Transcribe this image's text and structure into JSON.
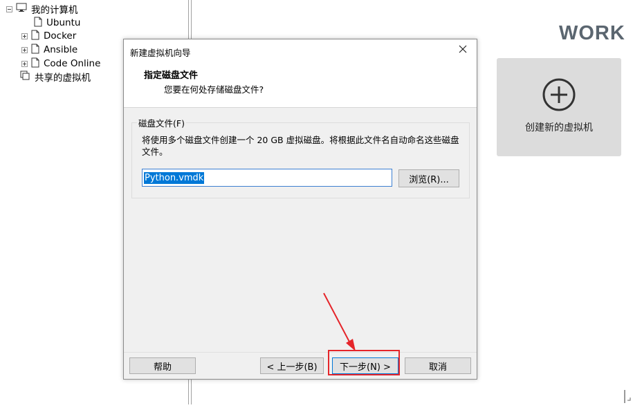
{
  "tree": {
    "items": [
      {
        "label": "我的计算机",
        "icon": "computer-icon",
        "expander": "minus"
      },
      {
        "label": "Ubuntu",
        "icon": "vm-page-icon",
        "expander": ""
      },
      {
        "label": "Docker",
        "icon": "vm-page-icon",
        "expander": "plus"
      },
      {
        "label": "Ansible",
        "icon": "vm-page-icon",
        "expander": "plus"
      },
      {
        "label": "Code Online",
        "icon": "vm-page-icon",
        "expander": "plus"
      },
      {
        "label": "共享的虚拟机",
        "icon": "shared-vms-icon",
        "expander": ""
      }
    ]
  },
  "home": {
    "title": "WORK",
    "create_tile_label": "创建新的虚拟机",
    "create_tile_icon": "plus-circle-icon"
  },
  "dialog": {
    "title": "新建虚拟机向导",
    "header_title": "指定磁盘文件",
    "header_subtitle": "您要在何处存储磁盘文件?",
    "group_label": "磁盘文件(F)",
    "description": "将使用多个磁盘文件创建一个 20 GB 虚拟磁盘。将根据此文件名自动命名这些磁盘文件。",
    "file_value": "Python.vmdk",
    "browse_label": "浏览(R)...",
    "help_label": "帮助",
    "back_label": "< 上一步(B)",
    "next_label": "下一步(N) >",
    "cancel_label": "取消"
  },
  "colors": {
    "annotation_red": "#e5252a",
    "selection_blue": "#0078d7",
    "tile_gray": "#dcdcdc"
  }
}
